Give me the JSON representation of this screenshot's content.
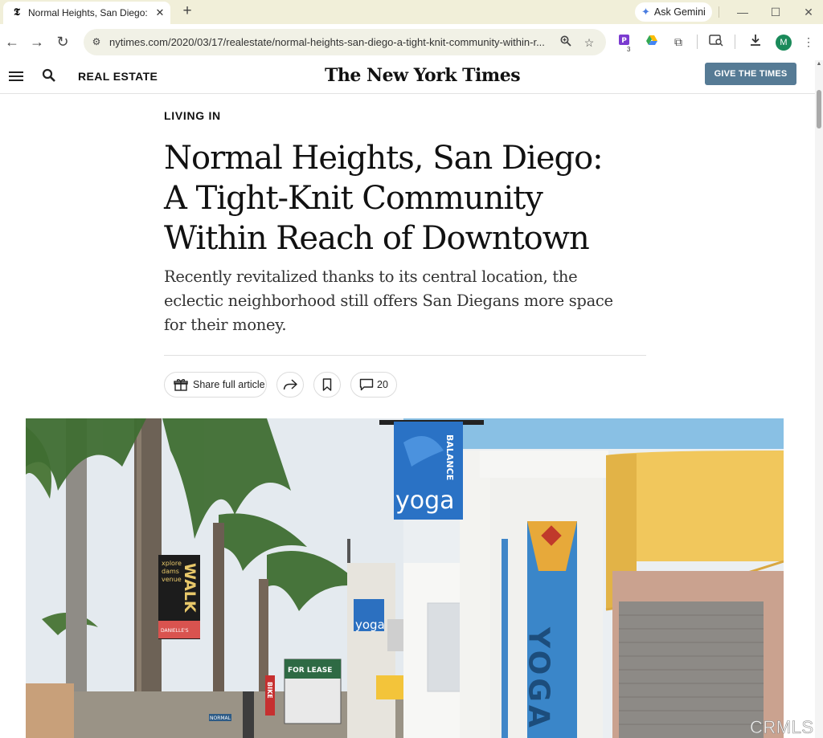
{
  "browser": {
    "tab": {
      "favicon": "𝕿",
      "title": "Normal Heights, San Diego: A Tight-Knit Community Within Reach of Downtown",
      "close": "✕"
    },
    "new_tab": "+",
    "gemini_label": "Ask Gemini",
    "url": "nytimes.com/2020/03/17/realestate/normal-heights-san-diego-a-tight-knit-community-within-r...",
    "extension_badge": "3",
    "profile_initial": "M"
  },
  "site": {
    "section": "REAL ESTATE",
    "logo": "The New York Times",
    "cta": "GIVE THE TIMES"
  },
  "article": {
    "kicker": "LIVING IN",
    "headline": "Normal Heights, San Diego: A Tight-Knit Community Within Reach of Downtown",
    "summary": "Recently revitalized thanks to its central location, the eclectic neighborhood still offers San Diegans more space for their money.",
    "share_label": "Share full article",
    "comment_count": "20"
  },
  "photo": {
    "signs": {
      "banner_brand": "yoga",
      "banner_side": "BALANCE",
      "walk": "WALK",
      "walk_small1": "xplore",
      "walk_small2": "dams",
      "walk_small3": "venue",
      "walk_bottom": "DANIELLE'S",
      "pillar": "YOGA",
      "lease": "FOR LEASE",
      "bike": "BIKE",
      "street": "NORMAL"
    },
    "watermark": "CRMLS"
  },
  "colors": {
    "tabstrip": "#f1efd9",
    "cta": "#567b95",
    "sky": "#dfe6ec"
  }
}
